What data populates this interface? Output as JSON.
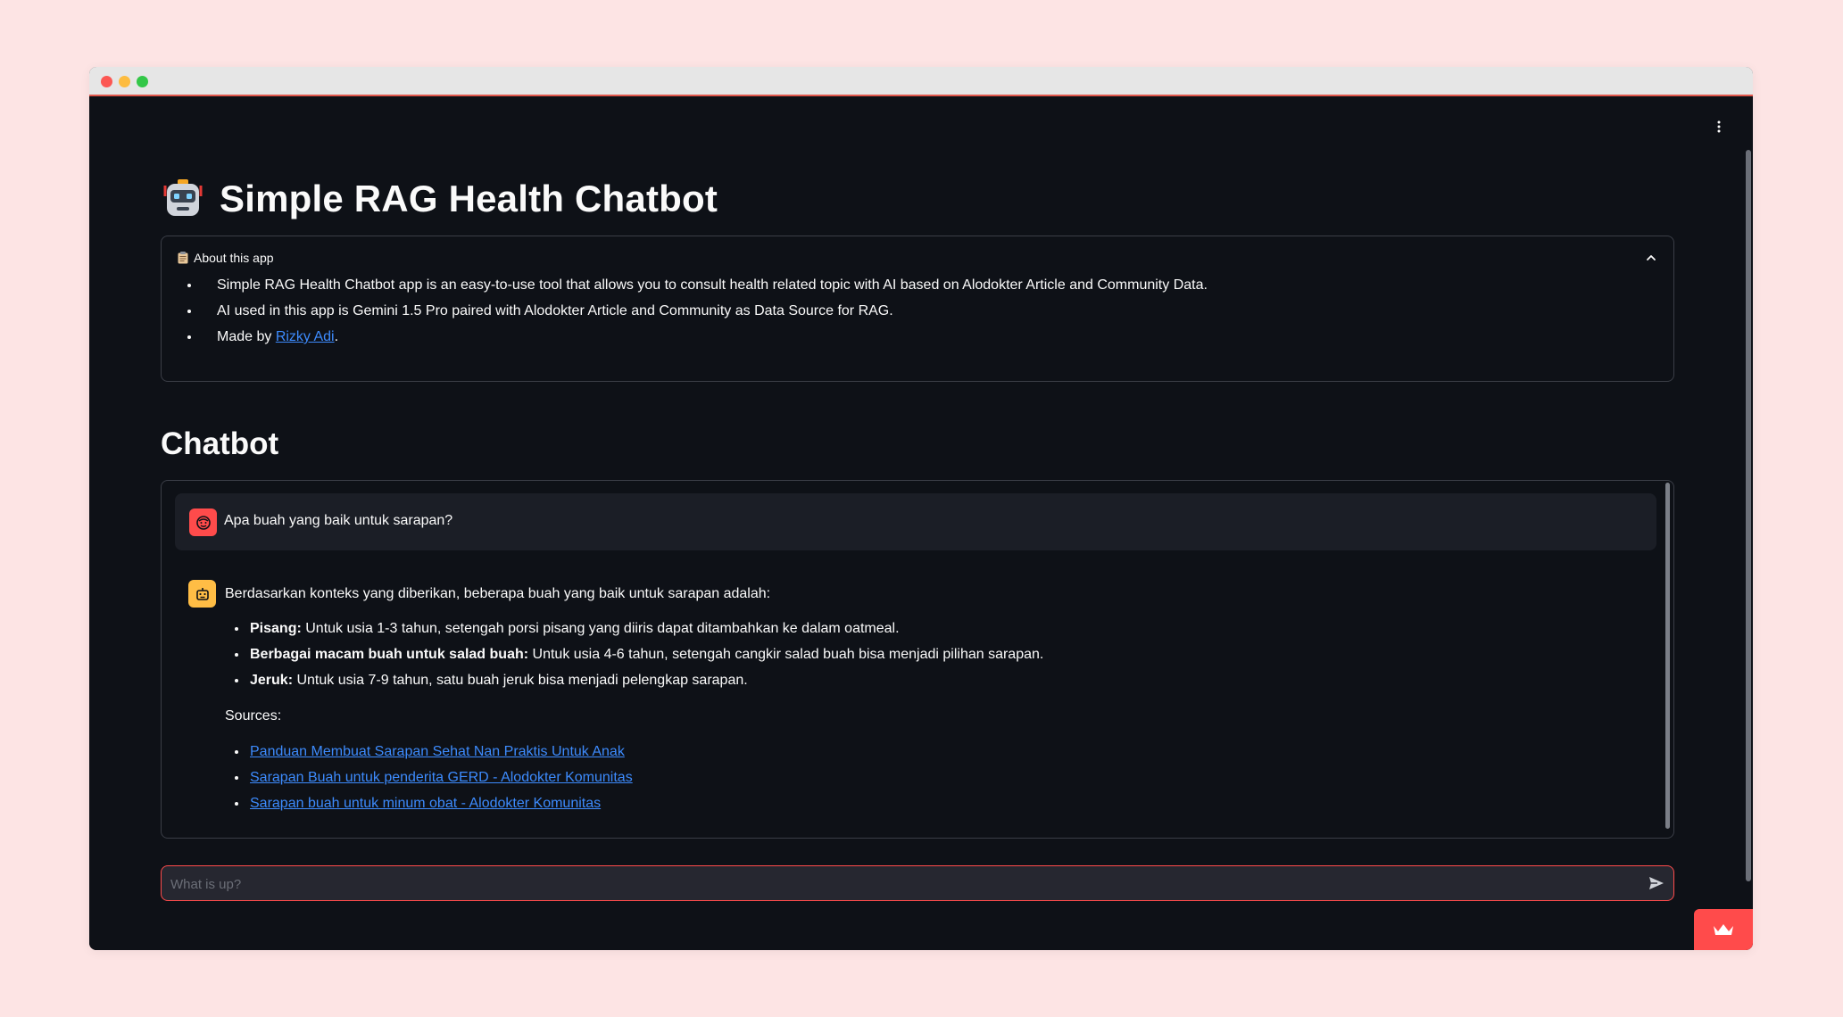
{
  "window": {
    "controls": [
      "close",
      "minimize",
      "maximize"
    ]
  },
  "header": {
    "title": "Simple RAG Health Chatbot",
    "title_icon": "robot-icon",
    "menu_icon": "vertical-dots-icon"
  },
  "about": {
    "label": "About this app",
    "label_icon": "clipboard-icon",
    "expanded": true,
    "items": [
      "Simple RAG Health Chatbot app is an easy-to-use tool that allows you to consult health related topic with AI based on Alodokter Article and Community Data.",
      "AI used in this app is Gemini 1.5 Pro paired with Alodokter Article and Community as Data Source for RAG."
    ],
    "made_by_prefix": "Made by ",
    "made_by_link": "Rizky Adi",
    "made_by_suffix": "."
  },
  "chat": {
    "heading": "Chatbot",
    "user_message": "Apa buah yang baik untuk sarapan?",
    "bot_intro": "Berdasarkan konteks yang diberikan, beberapa buah yang baik untuk sarapan adalah:",
    "bot_points": [
      {
        "bold": "Pisang:",
        "text": " Untuk usia 1-3 tahun, setengah porsi pisang yang diiris dapat ditambahkan ke dalam oatmeal."
      },
      {
        "bold": "Berbagai macam buah untuk salad buah:",
        "text": " Untuk usia 4-6 tahun, setengah cangkir salad buah bisa menjadi pilihan sarapan."
      },
      {
        "bold": "Jeruk:",
        "text": " Untuk usia 7-9 tahun, satu buah jeruk bisa menjadi pelengkap sarapan."
      }
    ],
    "sources_label": "Sources:",
    "sources": [
      "Panduan Membuat Sarapan Sehat Nan Praktis Untuk Anak",
      "Sarapan Buah untuk penderita GERD - Alodokter Komunitas",
      "Sarapan buah untuk minum obat - Alodokter Komunitas"
    ],
    "user_avatar_color": "#ff4b4b",
    "bot_avatar_color": "#ffbd45"
  },
  "input": {
    "placeholder": "What is up?",
    "value": "",
    "send_icon": "send-icon"
  },
  "colors": {
    "background": "#0e1117",
    "accent": "#ff4b4b",
    "link": "#3d8bfd",
    "page_outer": "#fde4e4"
  }
}
